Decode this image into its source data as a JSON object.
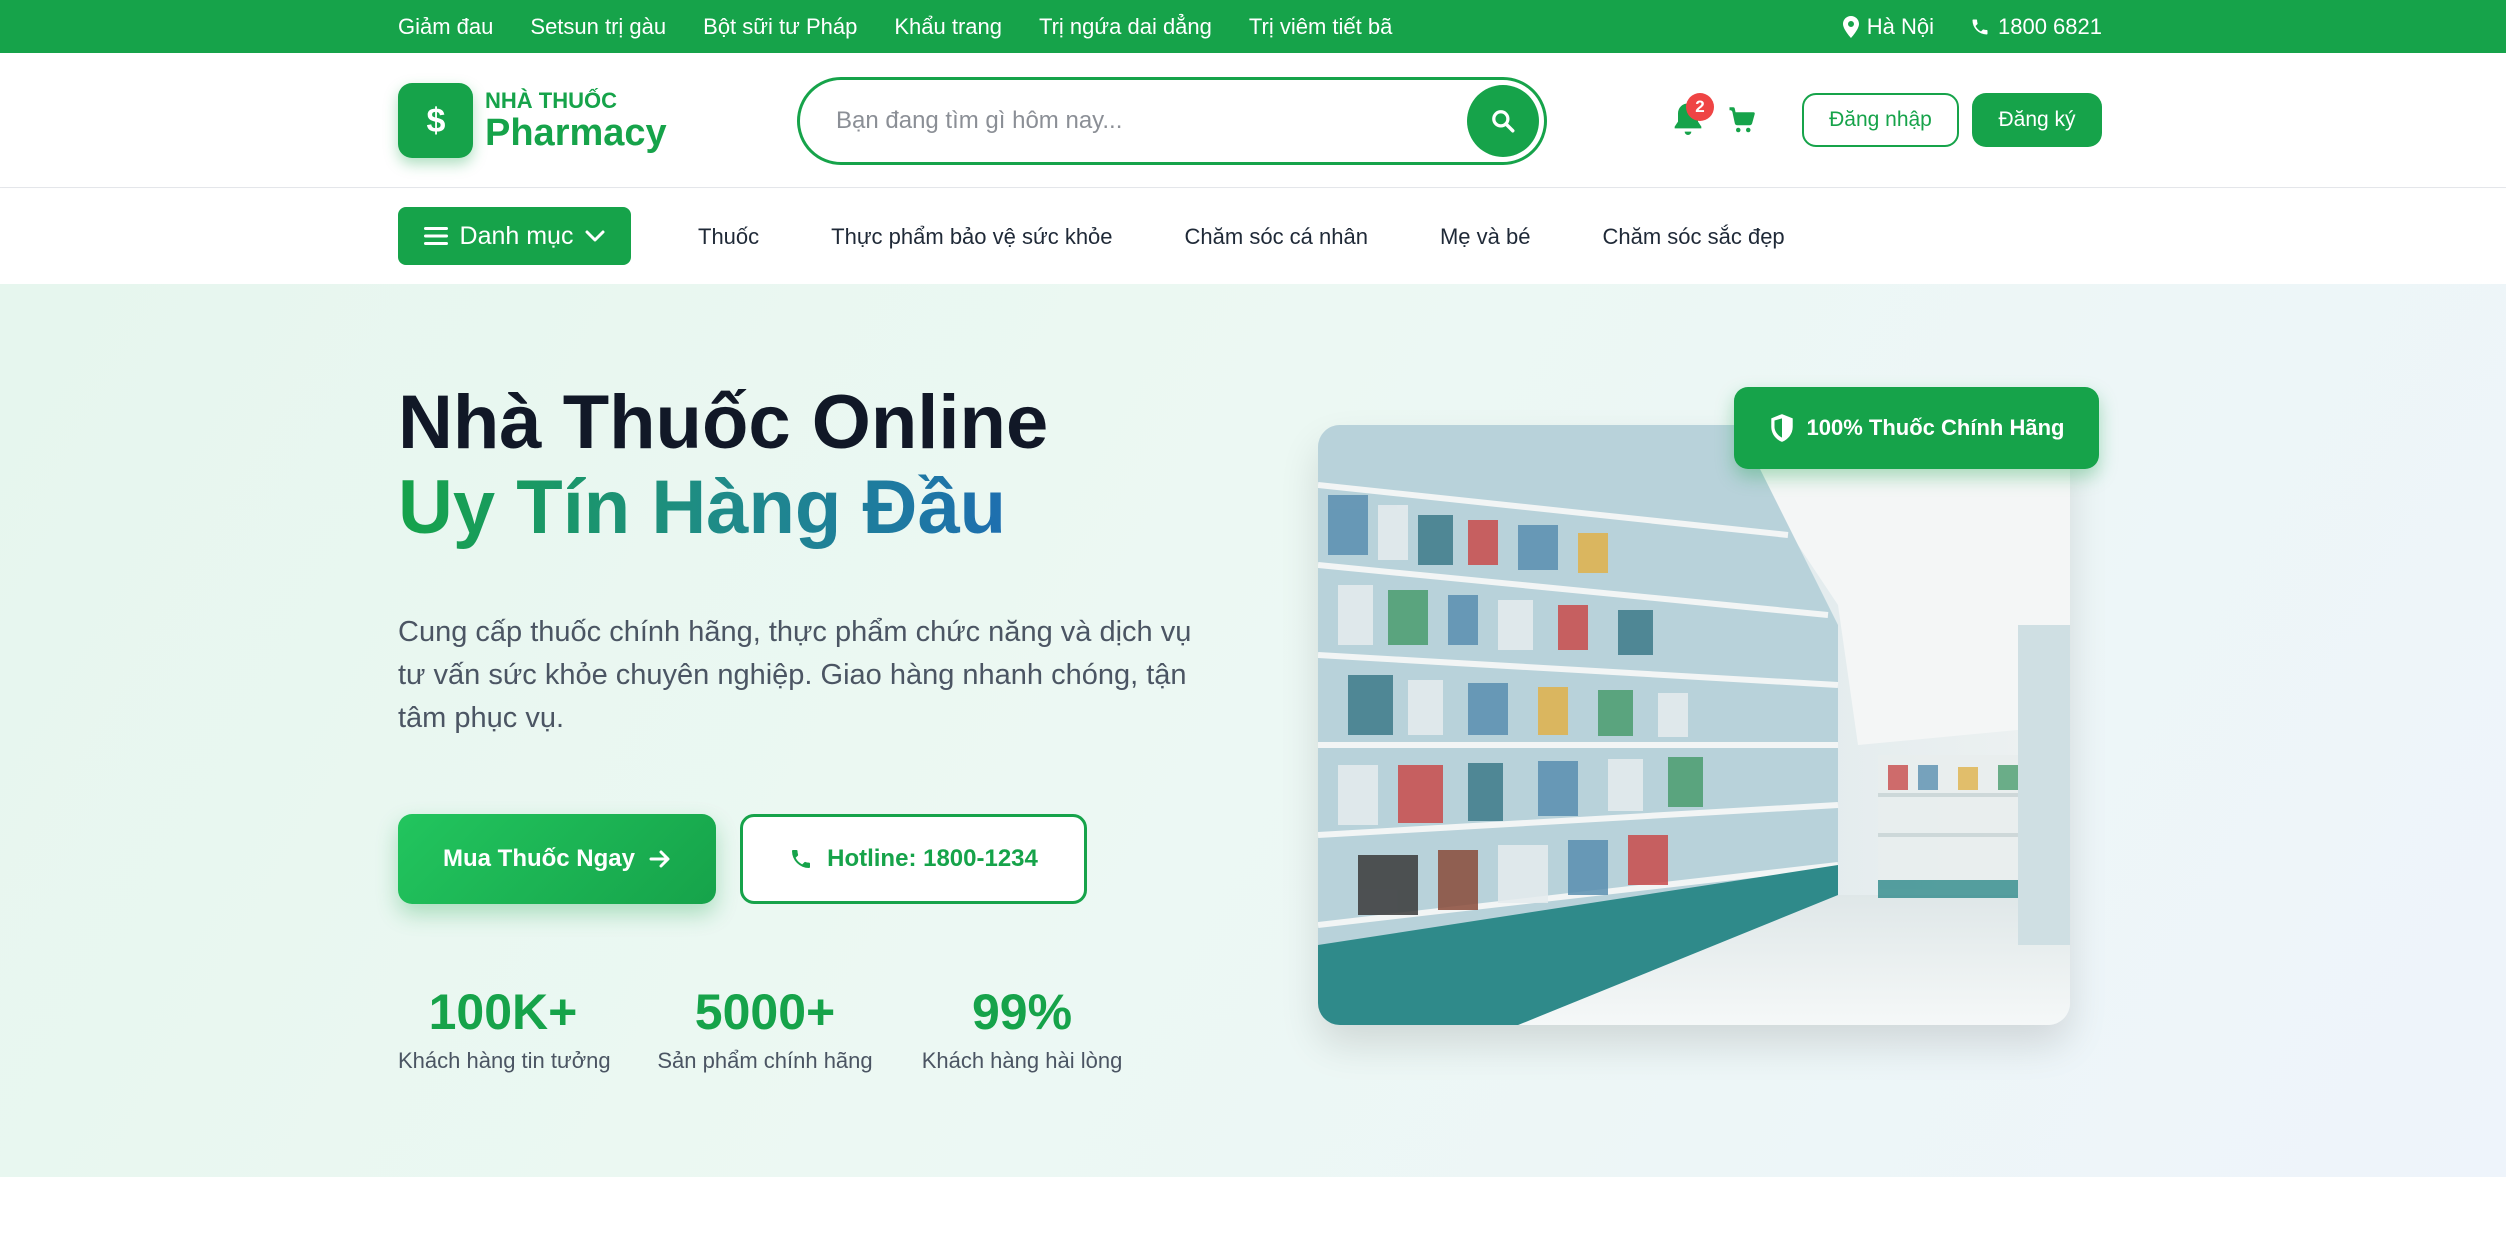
{
  "topbar": {
    "links": [
      "Giảm đau",
      "Setsun trị gàu",
      "Bột sữi tư Pháp",
      "Khẩu trang",
      "Trị ngứa dai dẳng",
      "Trị viêm tiết bã"
    ],
    "location": "Hà Nội",
    "phone": "1800 6821"
  },
  "header": {
    "logo_small": "NHÀ THUỐC",
    "logo_big": "Pharmacy",
    "search_placeholder": "Bạn đang tìm gì hôm nay...",
    "notification_count": "2",
    "login_label": "Đăng nhập",
    "register_label": "Đăng ký"
  },
  "nav": {
    "category_label": "Danh mục",
    "items": [
      "Thuốc",
      "Thực phẩm bảo vệ sức khỏe",
      "Chăm sóc cá nhân",
      "Mẹ và bé",
      "Chăm sóc sắc đẹp"
    ]
  },
  "hero": {
    "title_line1": "Nhà Thuốc Online",
    "title_line2": "Uy Tín Hàng Đầu",
    "description": "Cung cấp thuốc chính hãng, thực phẩm chức năng và dịch vụ tư vấn sức khỏe chuyên nghiệp. Giao hàng nhanh chóng, tận tâm phục vụ.",
    "buy_label": "Mua Thuốc Ngay",
    "hotline_label": "Hotline: 1800-1234",
    "badge_label": "100% Thuốc Chính Hãng",
    "stats": [
      {
        "value": "100K+",
        "label": "Khách hàng tin tưởng"
      },
      {
        "value": "5000+",
        "label": "Sản phẩm chính hãng"
      },
      {
        "value": "99%",
        "label": "Khách hàng hài lòng"
      }
    ]
  },
  "colors": {
    "brand": "#16a34a",
    "badge": "#ef4444"
  }
}
